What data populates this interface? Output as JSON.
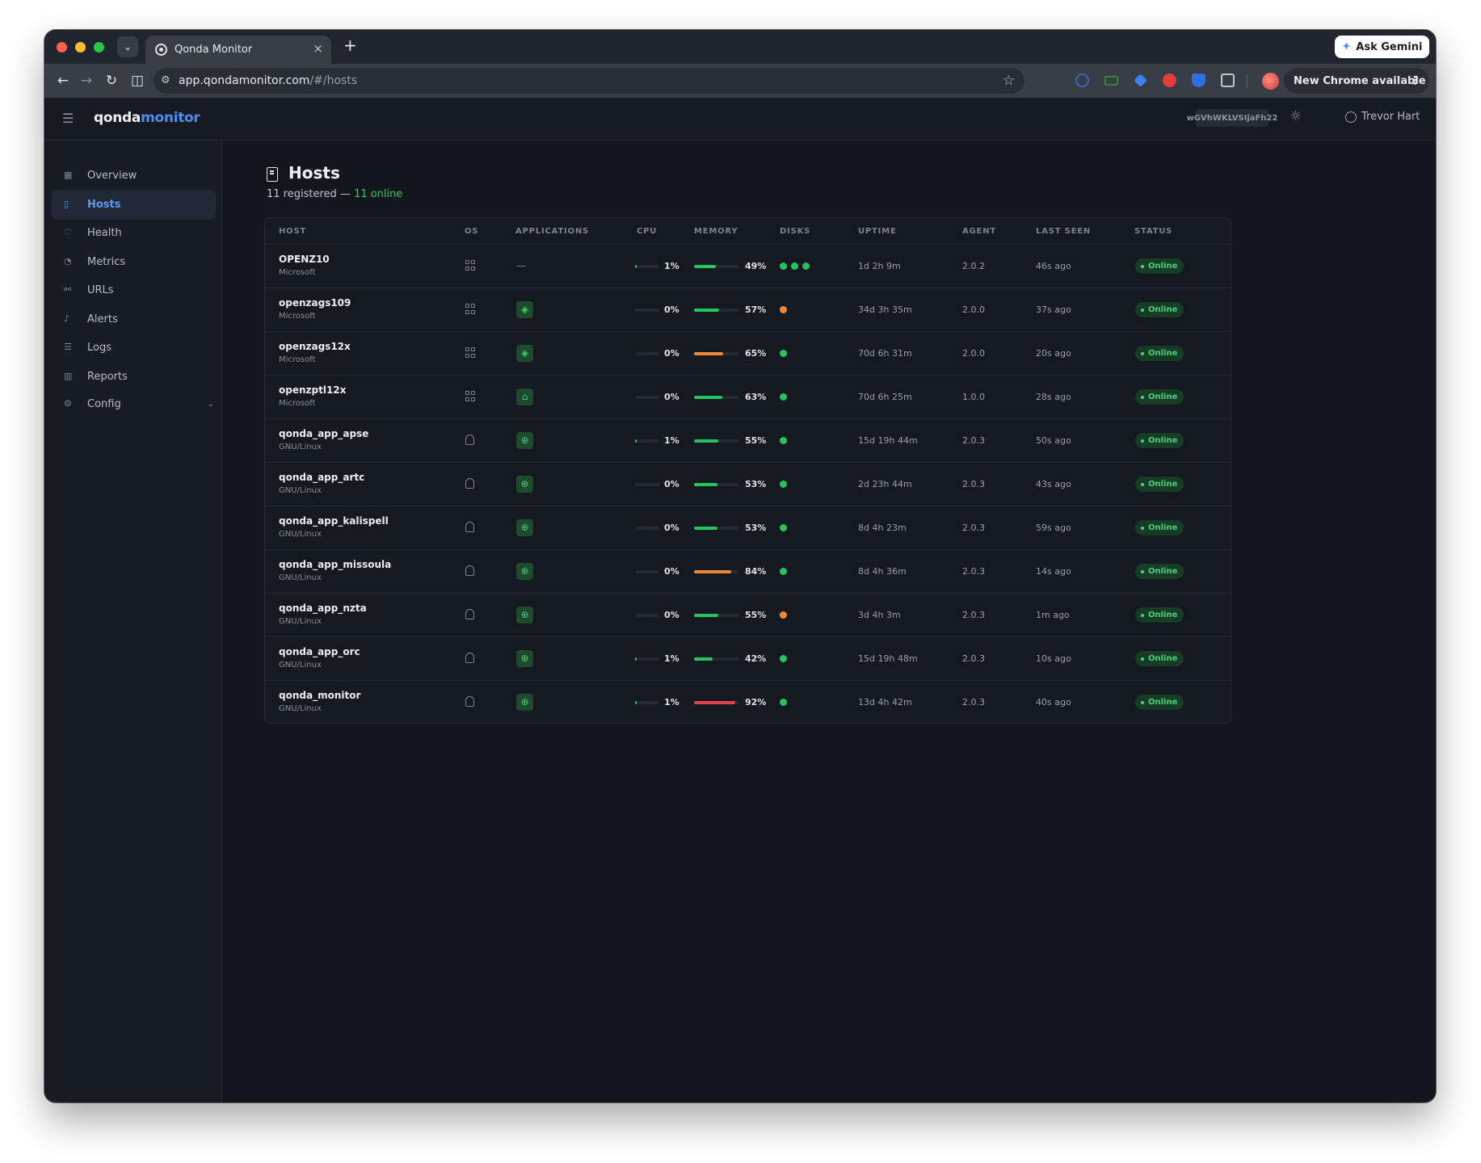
{
  "browser": {
    "tab_title": "Qonda Monitor",
    "url_domain": "app.qondamonitor.com",
    "url_path": "/#/hosts",
    "gemini_label": "Ask Gemini",
    "update_label": "New Chrome available"
  },
  "app": {
    "logo_part1": "qonda",
    "logo_part2": "monitor",
    "tenant_id": "wGVhWKLVSIjaFh22",
    "user_name": "Trevor Hart"
  },
  "sidebar": {
    "items": [
      {
        "label": "Overview",
        "icon": "grid-icon"
      },
      {
        "label": "Hosts",
        "icon": "server-icon",
        "active": true
      },
      {
        "label": "Health",
        "icon": "heart-icon"
      },
      {
        "label": "Metrics",
        "icon": "gauge-icon"
      },
      {
        "label": "URLs",
        "icon": "link-icon"
      },
      {
        "label": "Alerts",
        "icon": "bell-icon"
      },
      {
        "label": "Logs",
        "icon": "list-icon"
      },
      {
        "label": "Reports",
        "icon": "bar-chart-icon"
      },
      {
        "label": "Config",
        "icon": "gear-icon",
        "expandable": true
      }
    ]
  },
  "page": {
    "title": "Hosts",
    "registered_text": "11 registered — ",
    "online_text": "11 online"
  },
  "table": {
    "headers": {
      "host": "HOST",
      "os": "OS",
      "applications": "APPLICATIONS",
      "cpu": "CPU",
      "memory": "MEMORY",
      "disks": "DISKS",
      "uptime": "UPTIME",
      "agent": "AGENT",
      "last_seen": "LAST SEEN",
      "status": "STATUS"
    },
    "colors": {
      "green": "#22c55e",
      "orange": "#f0873a",
      "red": "#e5414e"
    },
    "rows": [
      {
        "name": "OPENZ10",
        "os": "Microsoft",
        "os_icon": "windows-icon",
        "app": "—",
        "cpu": "1%",
        "cpu_level": 0.01,
        "mem": "49%",
        "mem_level": 0.49,
        "mem_color": "green",
        "disks": [
          "green",
          "green",
          "green"
        ],
        "uptime": "1d 2h 9m",
        "agent": "2.0.2",
        "last_seen": "46s ago",
        "status": "Online"
      },
      {
        "name": "openzags109",
        "os": "Microsoft",
        "os_icon": "windows-icon",
        "app": "layers-icon",
        "cpu": "0%",
        "cpu_level": 0.0,
        "mem": "57%",
        "mem_level": 0.57,
        "mem_color": "green",
        "disks": [
          "orange"
        ],
        "uptime": "34d 3h 35m",
        "agent": "2.0.0",
        "last_seen": "37s ago",
        "status": "Online"
      },
      {
        "name": "openzags12x",
        "os": "Microsoft",
        "os_icon": "windows-icon",
        "app": "layers-icon",
        "cpu": "0%",
        "cpu_level": 0.0,
        "mem": "65%",
        "mem_level": 0.65,
        "mem_color": "orange",
        "disks": [
          "green"
        ],
        "uptime": "70d 6h 31m",
        "agent": "2.0.0",
        "last_seen": "20s ago",
        "status": "Online"
      },
      {
        "name": "openzptl12x",
        "os": "Microsoft",
        "os_icon": "windows-icon",
        "app": "home-icon",
        "cpu": "0%",
        "cpu_level": 0.0,
        "mem": "63%",
        "mem_level": 0.63,
        "mem_color": "green",
        "disks": [
          "green"
        ],
        "uptime": "70d 6h 25m",
        "agent": "1.0.0",
        "last_seen": "28s ago",
        "status": "Online"
      },
      {
        "name": "qonda_app_apse",
        "os": "GNU/Linux",
        "os_icon": "linux-icon",
        "app": "globe-icon",
        "cpu": "1%",
        "cpu_level": 0.01,
        "mem": "55%",
        "mem_level": 0.55,
        "mem_color": "green",
        "disks": [
          "green"
        ],
        "uptime": "15d 19h 44m",
        "agent": "2.0.3",
        "last_seen": "50s ago",
        "status": "Online"
      },
      {
        "name": "qonda_app_artc",
        "os": "GNU/Linux",
        "os_icon": "linux-icon",
        "app": "globe-icon",
        "cpu": "0%",
        "cpu_level": 0.0,
        "mem": "53%",
        "mem_level": 0.53,
        "mem_color": "green",
        "disks": [
          "green"
        ],
        "uptime": "2d 23h 44m",
        "agent": "2.0.3",
        "last_seen": "43s ago",
        "status": "Online"
      },
      {
        "name": "qonda_app_kalispell",
        "os": "GNU/Linux",
        "os_icon": "linux-icon",
        "app": "globe-icon",
        "cpu": "0%",
        "cpu_level": 0.0,
        "mem": "53%",
        "mem_level": 0.53,
        "mem_color": "green",
        "disks": [
          "green"
        ],
        "uptime": "8d 4h 23m",
        "agent": "2.0.3",
        "last_seen": "59s ago",
        "status": "Online"
      },
      {
        "name": "qonda_app_missoula",
        "os": "GNU/Linux",
        "os_icon": "linux-icon",
        "app": "globe-icon",
        "cpu": "0%",
        "cpu_level": 0.0,
        "mem": "84%",
        "mem_level": 0.84,
        "mem_color": "orange",
        "disks": [
          "green"
        ],
        "uptime": "8d 4h 36m",
        "agent": "2.0.3",
        "last_seen": "14s ago",
        "status": "Online"
      },
      {
        "name": "qonda_app_nzta",
        "os": "GNU/Linux",
        "os_icon": "linux-icon",
        "app": "globe-icon",
        "cpu": "0%",
        "cpu_level": 0.0,
        "mem": "55%",
        "mem_level": 0.55,
        "mem_color": "green",
        "disks": [
          "orange"
        ],
        "uptime": "3d 4h 3m",
        "agent": "2.0.3",
        "last_seen": "1m ago",
        "status": "Online"
      },
      {
        "name": "qonda_app_orc",
        "os": "GNU/Linux",
        "os_icon": "linux-icon",
        "app": "globe-icon",
        "cpu": "1%",
        "cpu_level": 0.01,
        "mem": "42%",
        "mem_level": 0.42,
        "mem_color": "green",
        "disks": [
          "green"
        ],
        "uptime": "15d 19h 48m",
        "agent": "2.0.3",
        "last_seen": "10s ago",
        "status": "Online"
      },
      {
        "name": "qonda_monitor",
        "os": "GNU/Linux",
        "os_icon": "linux-icon",
        "app": "globe-icon",
        "cpu": "1%",
        "cpu_level": 0.01,
        "mem": "92%",
        "mem_level": 0.92,
        "mem_color": "red",
        "disks": [
          "green"
        ],
        "uptime": "13d 4h 42m",
        "agent": "2.0.3",
        "last_seen": "40s ago",
        "status": "Online"
      }
    ]
  }
}
